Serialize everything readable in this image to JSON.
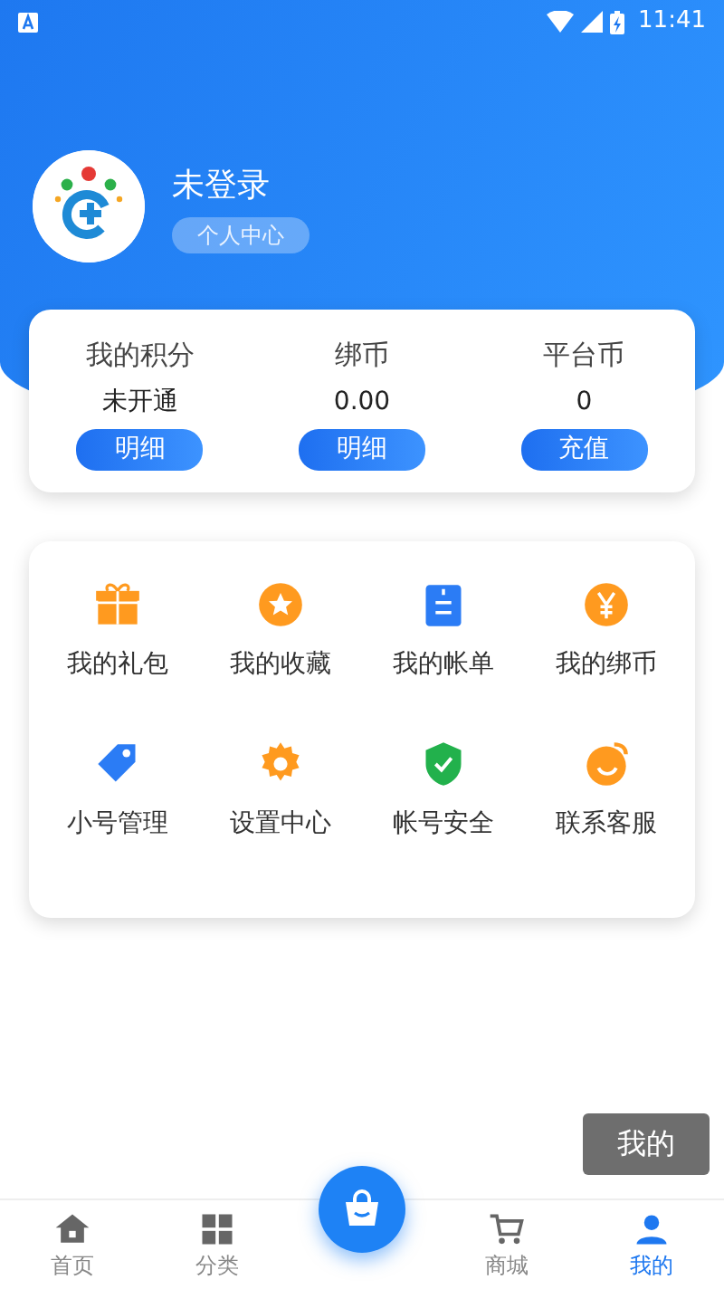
{
  "status_bar": {
    "time": "11:41"
  },
  "profile": {
    "name": "未登录",
    "link": "个人中心"
  },
  "stats": [
    {
      "label": "我的积分",
      "value": "未开通",
      "button": "明细"
    },
    {
      "label": "绑币",
      "value": "0.00",
      "button": "明细"
    },
    {
      "label": "平台币",
      "value": "0",
      "button": "充值"
    }
  ],
  "menu": [
    {
      "label": "我的礼包",
      "kind": "gift",
      "color": "#ff9a1f"
    },
    {
      "label": "我的收藏",
      "kind": "star",
      "color": "#ff9a1f"
    },
    {
      "label": "我的帐单",
      "kind": "bill",
      "color": "#2b7cf5"
    },
    {
      "label": "我的绑币",
      "kind": "yen",
      "color": "#ff9a1f"
    },
    {
      "label": "小号管理",
      "kind": "tag",
      "color": "#2b7cf5"
    },
    {
      "label": "设置中心",
      "kind": "gear",
      "color": "#ff9a1f"
    },
    {
      "label": "帐号安全",
      "kind": "shield",
      "color": "#22b14c"
    },
    {
      "label": "联系客服",
      "kind": "smile",
      "color": "#ff9a1f"
    }
  ],
  "toast": "我的",
  "tabs": [
    {
      "label": "首页",
      "kind": "home",
      "selected": false
    },
    {
      "label": "分类",
      "kind": "grid",
      "selected": false
    },
    {
      "kind": "center",
      "selected": false
    },
    {
      "label": "商城",
      "kind": "cart",
      "selected": false
    },
    {
      "label": "我的",
      "kind": "user",
      "selected": true
    }
  ]
}
